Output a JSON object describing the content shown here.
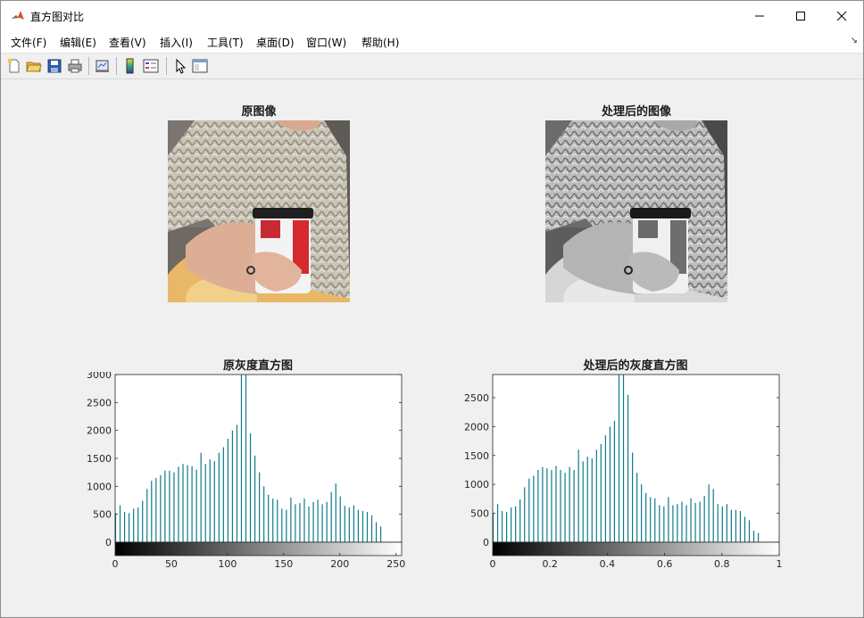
{
  "window": {
    "title": "直方图对比",
    "controls": [
      "minimize-icon",
      "maximize-icon",
      "close-icon"
    ]
  },
  "menubar": {
    "items": [
      "文件(F)",
      "编辑(E)",
      "查看(V)",
      "插入(I)",
      "工具(T)",
      "桌面(D)",
      "窗口(W)",
      "帮助(H)"
    ]
  },
  "toolbar": {
    "icons": [
      "new-figure-icon",
      "open-file-icon",
      "save-icon",
      "print-icon",
      "link-plot-icon",
      "insert-colorbar-icon",
      "insert-legend-icon",
      "edit-plot-icon",
      "property-inspector-icon"
    ]
  },
  "figure": {
    "original_image_title": "原图像",
    "processed_image_title": "处理后的图像",
    "original_hist_title": "原灰度直方图",
    "processed_hist_title": "处理后的灰度直方图"
  },
  "chart_data": [
    {
      "type": "bar",
      "title": "原灰度直方图",
      "x": [
        0,
        4,
        8,
        12,
        16,
        20,
        24,
        28,
        32,
        36,
        40,
        44,
        48,
        52,
        56,
        60,
        64,
        68,
        72,
        76,
        80,
        84,
        88,
        92,
        96,
        100,
        104,
        108,
        112,
        116,
        120,
        124,
        128,
        132,
        136,
        140,
        144,
        148,
        152,
        156,
        160,
        164,
        168,
        172,
        176,
        180,
        184,
        188,
        192,
        196,
        200,
        204,
        208,
        212,
        216,
        220,
        224,
        228,
        232,
        236,
        240,
        244,
        248,
        252
      ],
      "values": [
        520,
        660,
        540,
        520,
        600,
        620,
        740,
        950,
        1100,
        1150,
        1200,
        1280,
        1280,
        1250,
        1350,
        1400,
        1380,
        1360,
        1300,
        1600,
        1400,
        1480,
        1450,
        1600,
        1700,
        1850,
        2000,
        2100,
        3000,
        3000,
        1950,
        1550,
        1250,
        1000,
        850,
        780,
        760,
        600,
        580,
        800,
        680,
        700,
        780,
        640,
        720,
        760,
        680,
        720,
        900,
        1050,
        820,
        650,
        620,
        660,
        580,
        560,
        540,
        480,
        360,
        280,
        0,
        0,
        0,
        0
      ],
      "xlim": [
        0,
        255
      ],
      "ylim": [
        0,
        3000
      ],
      "xticks": [
        0,
        50,
        100,
        150,
        200,
        250
      ],
      "yticks": [
        0,
        500,
        1000,
        1500,
        2000,
        2500,
        3000
      ],
      "color": "#0e7a8a",
      "colorbar": "grayscale"
    },
    {
      "type": "bar",
      "title": "处理后的灰度直方图",
      "x": [
        0,
        0.0157,
        0.0314,
        0.0471,
        0.0627,
        0.0784,
        0.0941,
        0.1098,
        0.1255,
        0.1412,
        0.1569,
        0.1725,
        0.1882,
        0.2039,
        0.2196,
        0.2353,
        0.251,
        0.2667,
        0.2824,
        0.298,
        0.3137,
        0.3294,
        0.3451,
        0.3608,
        0.3765,
        0.3922,
        0.4078,
        0.4235,
        0.4392,
        0.4549,
        0.4706,
        0.4863,
        0.502,
        0.5176,
        0.5333,
        0.549,
        0.5647,
        0.5804,
        0.5961,
        0.6118,
        0.6275,
        0.6431,
        0.6588,
        0.6745,
        0.6902,
        0.7059,
        0.7216,
        0.7373,
        0.7529,
        0.7686,
        0.7843,
        0.8,
        0.8157,
        0.8314,
        0.8471,
        0.8627,
        0.8784,
        0.8941,
        0.9098,
        0.9255,
        0.9412,
        0.9569,
        0.9725,
        0.9882
      ],
      "values": [
        500,
        660,
        540,
        520,
        600,
        620,
        740,
        950,
        1100,
        1150,
        1250,
        1300,
        1280,
        1250,
        1320,
        1250,
        1200,
        1300,
        1250,
        1600,
        1400,
        1480,
        1450,
        1600,
        1700,
        1850,
        2000,
        2100,
        2900,
        2900,
        2550,
        1550,
        1200,
        1000,
        850,
        780,
        760,
        640,
        620,
        780,
        640,
        660,
        700,
        640,
        760,
        680,
        700,
        800,
        1000,
        920,
        660,
        620,
        660,
        560,
        560,
        540,
        440,
        380,
        200,
        160,
        0,
        0,
        0,
        0
      ],
      "xlim": [
        0,
        1
      ],
      "ylim": [
        0,
        2900
      ],
      "xticks": [
        0,
        0.2,
        0.4,
        0.6,
        0.8,
        1
      ],
      "yticks": [
        0,
        500,
        1000,
        1500,
        2000,
        2500
      ],
      "color": "#0e7a8a",
      "colorbar": "grayscale"
    }
  ]
}
